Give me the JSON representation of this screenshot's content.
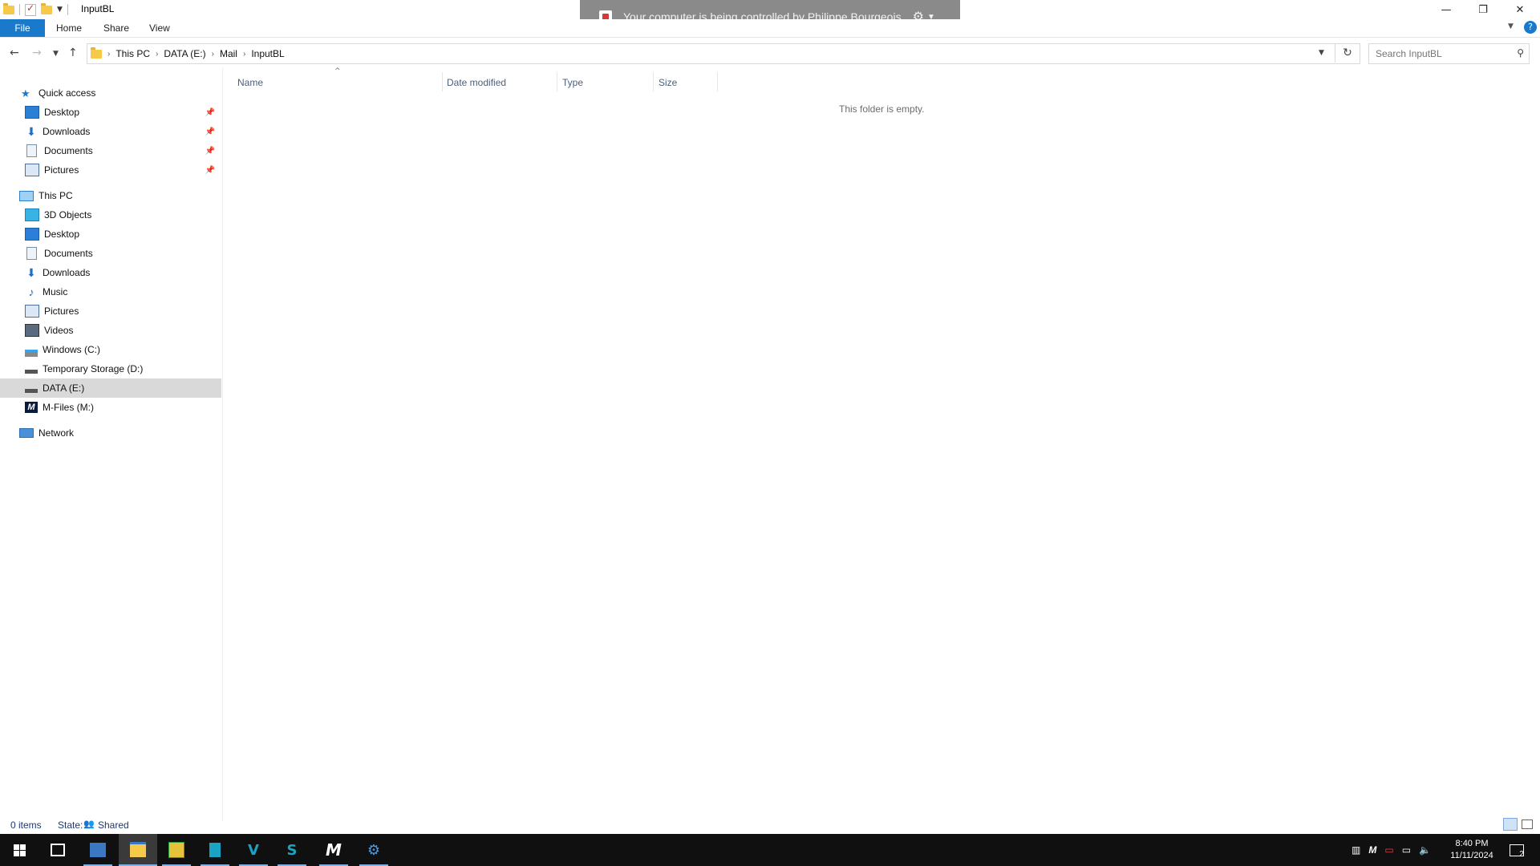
{
  "window": {
    "title": "InputBL",
    "controls": {
      "minimize": "—",
      "restore": "❐",
      "close": "✕"
    }
  },
  "banner": {
    "text": "Your computer is being controlled by Philippe Bourgeois"
  },
  "ribbon": {
    "tabs": [
      "File",
      "Home",
      "Share",
      "View"
    ]
  },
  "address": {
    "crumbs": [
      "This PC",
      "DATA (E:)",
      "Mail",
      "InputBL"
    ]
  },
  "search": {
    "placeholder": "Search InputBL"
  },
  "navpane": {
    "quick_access": {
      "label": "Quick access",
      "items": [
        "Desktop",
        "Downloads",
        "Documents",
        "Pictures"
      ]
    },
    "this_pc": {
      "label": "This PC",
      "items": [
        "3D Objects",
        "Desktop",
        "Documents",
        "Downloads",
        "Music",
        "Pictures",
        "Videos",
        "Windows (C:)",
        "Temporary Storage (D:)",
        "DATA (E:)",
        "M-Files (M:)"
      ]
    },
    "network": {
      "label": "Network"
    },
    "selected": "DATA (E:)"
  },
  "columns": [
    "Name",
    "Date modified",
    "Type",
    "Size"
  ],
  "content": {
    "empty_text": "This folder is empty."
  },
  "status": {
    "items": "0 items",
    "state_label": "State:",
    "state_value": "Shared"
  },
  "taskbar": {
    "time": "8:40 PM",
    "date": "11/11/2024",
    "notifications": "2"
  },
  "colors": {
    "file_tab": "#1979ca",
    "banner": "#8a8a8a",
    "selection": "#d9d9d9",
    "taskbar": "#101010"
  }
}
